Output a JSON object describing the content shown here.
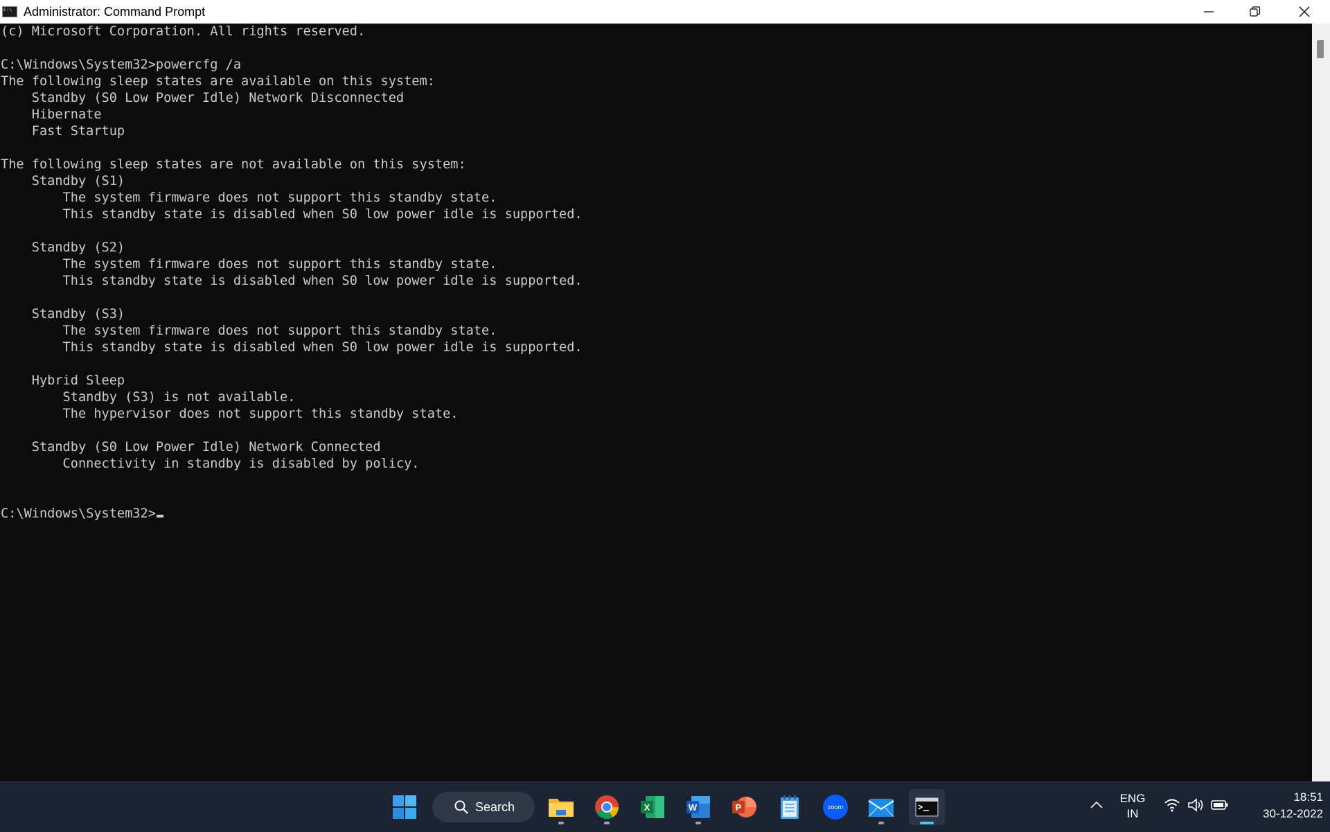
{
  "window": {
    "title": "Administrator: Command Prompt"
  },
  "console": {
    "lines": [
      "(c) Microsoft Corporation. All rights reserved.",
      "",
      "C:\\Windows\\System32>powercfg /a",
      "The following sleep states are available on this system:",
      "    Standby (S0 Low Power Idle) Network Disconnected",
      "    Hibernate",
      "    Fast Startup",
      "",
      "The following sleep states are not available on this system:",
      "    Standby (S1)",
      "        The system firmware does not support this standby state.",
      "        This standby state is disabled when S0 low power idle is supported.",
      "",
      "    Standby (S2)",
      "        The system firmware does not support this standby state.",
      "        This standby state is disabled when S0 low power idle is supported.",
      "",
      "    Standby (S3)",
      "        The system firmware does not support this standby state.",
      "        This standby state is disabled when S0 low power idle is supported.",
      "",
      "    Hybrid Sleep",
      "        Standby (S3) is not available.",
      "        The hypervisor does not support this standby state.",
      "",
      "    Standby (S0 Low Power Idle) Network Connected",
      "        Connectivity in standby is disabled by policy.",
      "",
      ""
    ],
    "prompt": "C:\\Windows\\System32>"
  },
  "taskbar": {
    "search_label": "Search",
    "apps": [
      {
        "icon": "file-explorer-icon"
      },
      {
        "icon": "chrome-icon"
      },
      {
        "icon": "excel-icon"
      },
      {
        "icon": "word-icon"
      },
      {
        "icon": "powerpoint-icon"
      },
      {
        "icon": "notepad-icon"
      },
      {
        "icon": "zoom-icon",
        "label": "zoom"
      },
      {
        "icon": "mail-icon"
      },
      {
        "icon": "command-prompt-icon"
      }
    ],
    "tray": {
      "language_line1": "ENG",
      "language_line2": "IN",
      "time": "18:51",
      "date": "30-12-2022"
    }
  },
  "colors": {
    "console_bg": "#0c0c0c",
    "console_text": "#cccccc",
    "taskbar_bg": "#1c2433",
    "accent": "#4cc2ff"
  }
}
